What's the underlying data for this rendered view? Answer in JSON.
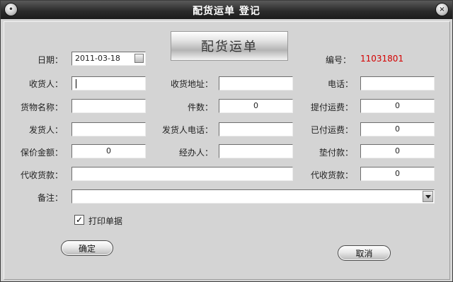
{
  "window": {
    "title": "配货运单 登记"
  },
  "titlebar_buttons": {
    "menu_icon": "menu-dot-icon",
    "close_icon": "close-icon"
  },
  "banner": {
    "text": "配货运单"
  },
  "form": {
    "date_label": "日期：",
    "date_value": "2011-03-18",
    "number_label": "编号：",
    "number_value": "11031801",
    "receiver_label": "收货人：",
    "receiver_value": "",
    "receiver_address_label": "收货地址：",
    "receiver_address_value": "",
    "phone_label": "电话：",
    "phone_value": "",
    "goods_name_label": "货物名称：",
    "goods_name_value": "",
    "pieces_label": "件数：",
    "pieces_value": "0",
    "freight_on_pickup_label": "提付运费：",
    "freight_on_pickup_value": "0",
    "sender_label": "发货人：",
    "sender_value": "",
    "sender_phone_label": "发货人电话：",
    "sender_phone_value": "",
    "freight_paid_label": "已付运费：",
    "freight_paid_value": "0",
    "insured_amount_label": "保价金额：",
    "insured_amount_value": "0",
    "handler_label": "经办人：",
    "handler_value": "",
    "advance_payment_label": "垫付款：",
    "advance_payment_value": "0",
    "cod_left_label": "代收货款：",
    "cod_left_value": "",
    "cod_right_label": "代收货款：",
    "cod_right_value": "0",
    "remarks_label": "备注：",
    "remarks_value": ""
  },
  "print_checkbox": {
    "label": "打印单据",
    "checked": true,
    "mark": "✓"
  },
  "buttons": {
    "ok": "确定",
    "cancel": "取消"
  },
  "colors": {
    "number_value": "#d40000",
    "titlebar": "#2c2c2c",
    "panel": "#d4d4d4"
  }
}
